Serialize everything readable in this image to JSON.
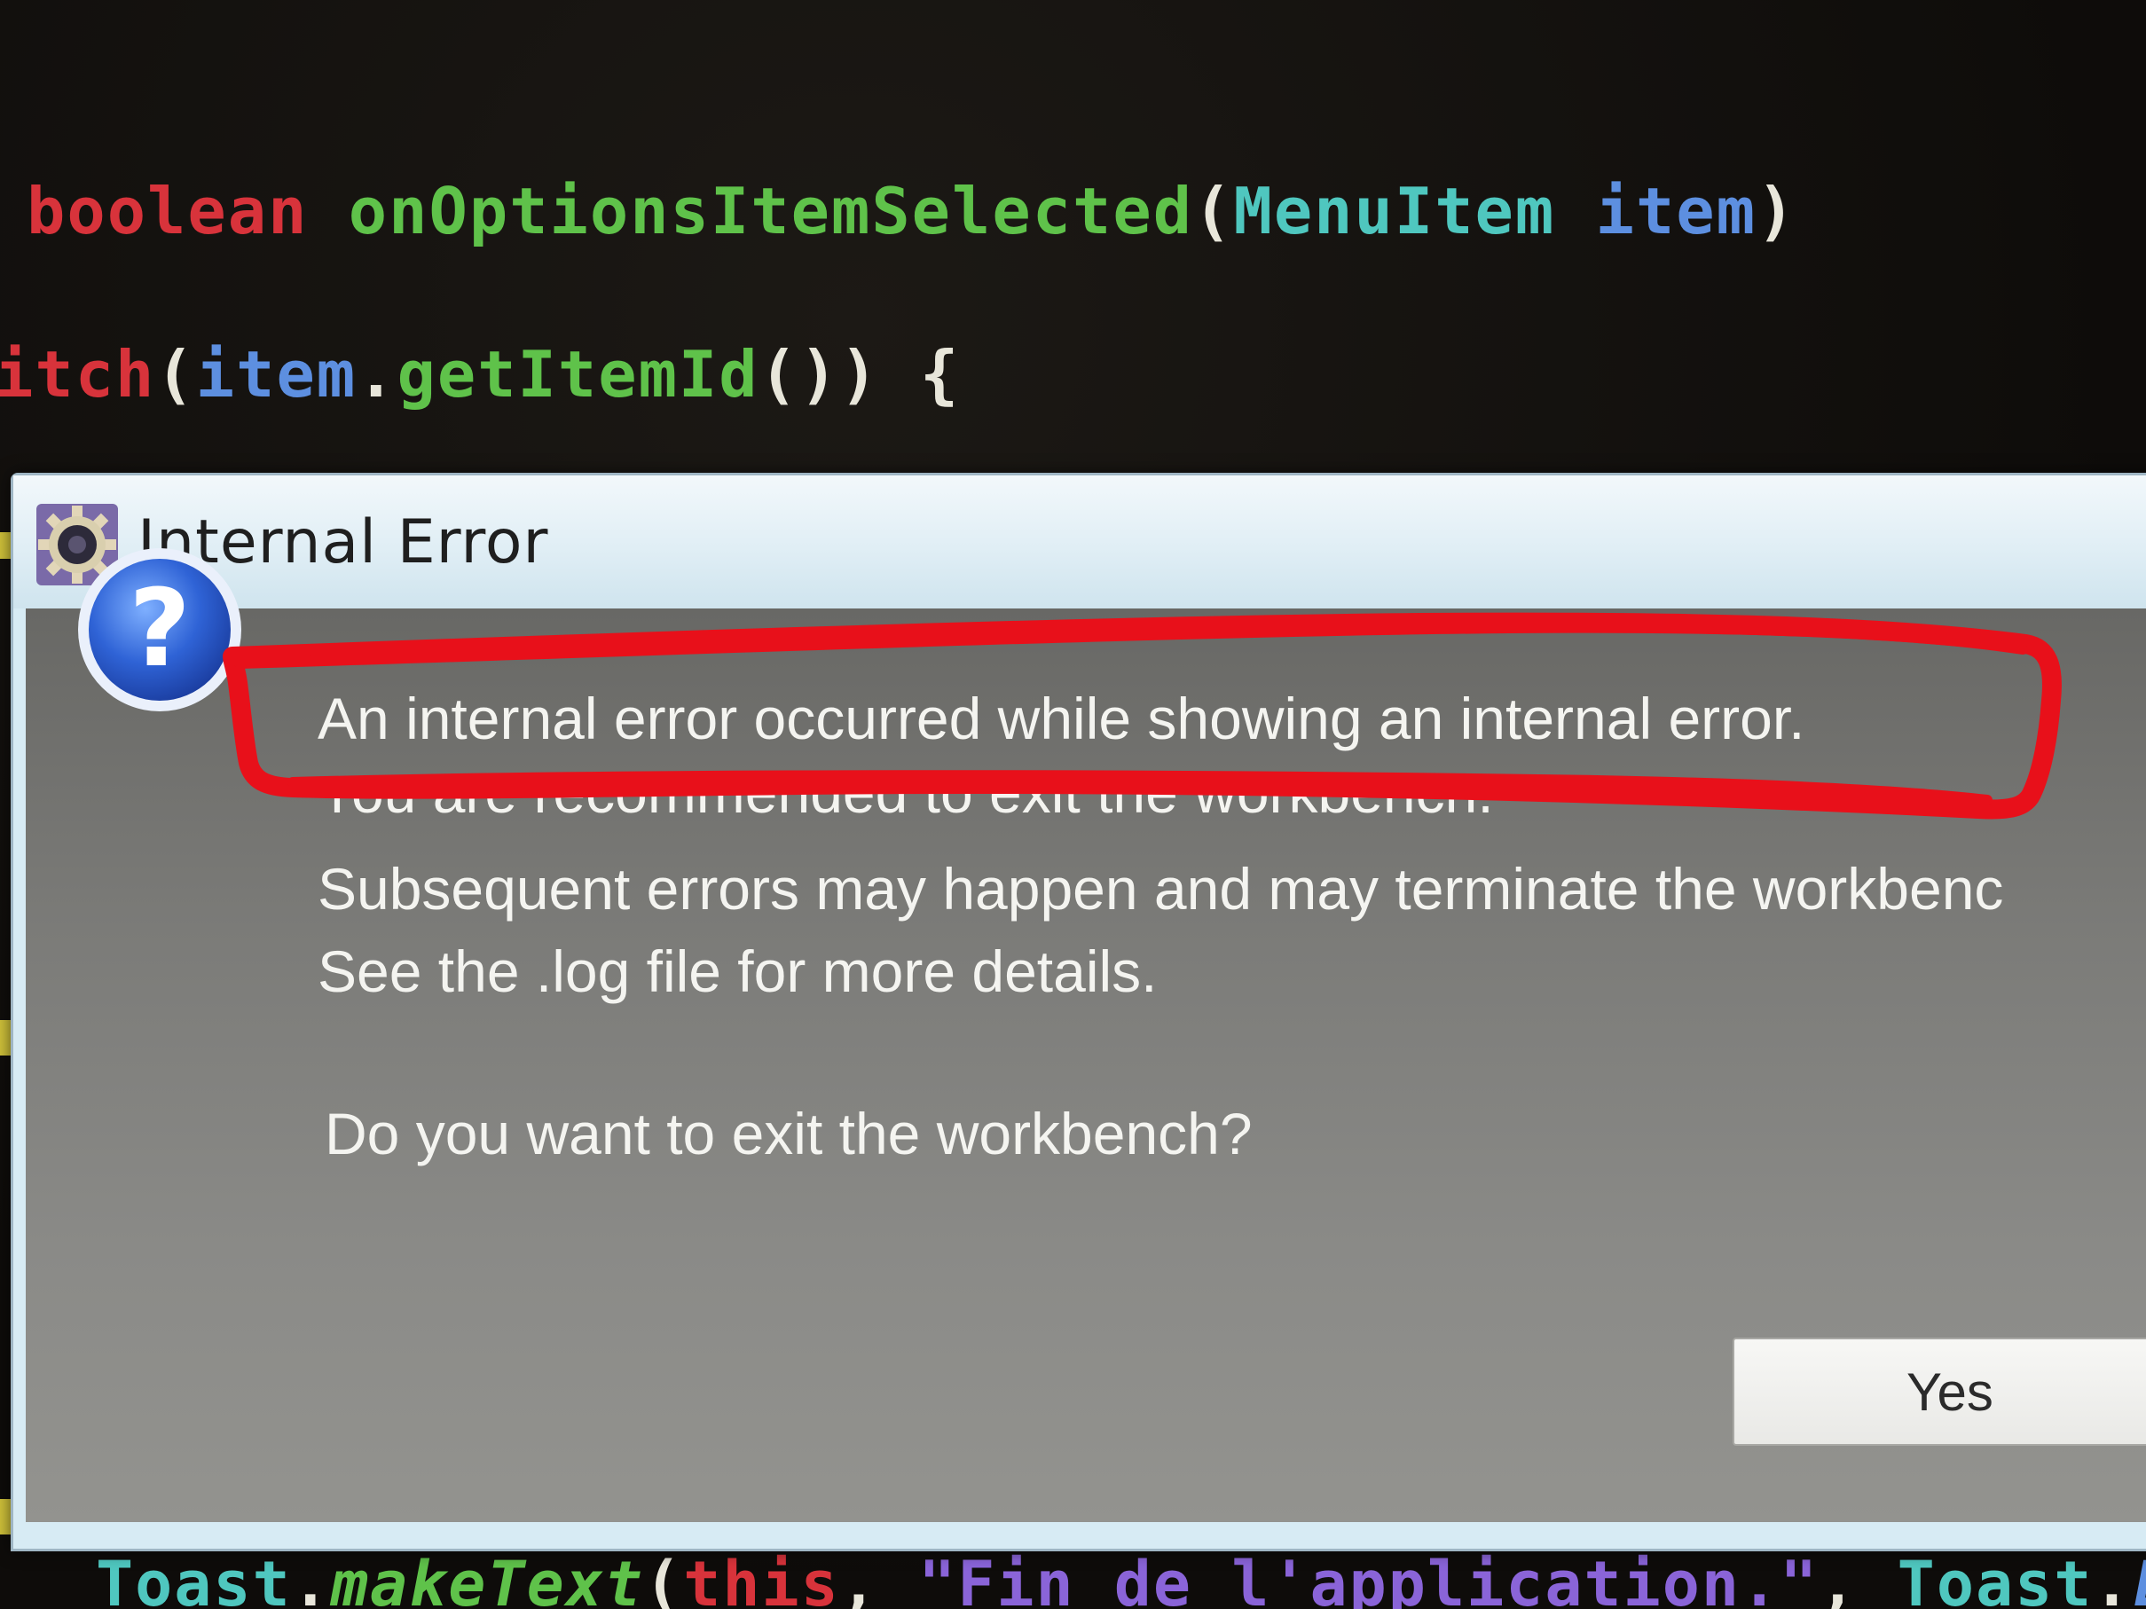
{
  "editor": {
    "line1": {
      "keyword": "boolean",
      "method": "onOptionsItemSelected",
      "open_paren": "(",
      "param_type": "MenuItem",
      "param_name": "item",
      "close_paren": ")"
    },
    "line2": {
      "keyword": "itch",
      "open_paren": "(",
      "object": "item",
      "dot": ".",
      "method": "getItemId",
      "tail": "()) {"
    },
    "bottom_line": {
      "class": "Toast",
      "dot1": ".",
      "method": "makeText",
      "open_paren": "(",
      "this_kw": "this",
      "sep1": ", ",
      "string": "\"Fin de l'application.\"",
      "sep2": ", ",
      "class2": "Toast",
      "dot2": ".",
      "constant": "LENG"
    },
    "colors": {
      "keyword": "#d8333b",
      "method": "#5fc24a",
      "type": "#4fc7bf",
      "variable": "#5d8fe0",
      "punctuation": "#e8e6da",
      "string": "#8a64d8"
    }
  },
  "dialog": {
    "title": "Internal Error",
    "title_icon": "eclipse-gear-icon",
    "message_icon": "question-icon",
    "message": {
      "line1": "An internal error occurred while showing an internal error.",
      "line2": "You are recommended to exit the workbench.",
      "line3": "Subsequent errors may happen and may terminate the workbenc",
      "line4": "See the .log file for more details.",
      "question": "Do you want to exit the workbench?"
    },
    "buttons": {
      "yes_label": "Yes"
    }
  },
  "annotation": {
    "color": "#e8101a",
    "shape": "hand-drawn-outline"
  }
}
